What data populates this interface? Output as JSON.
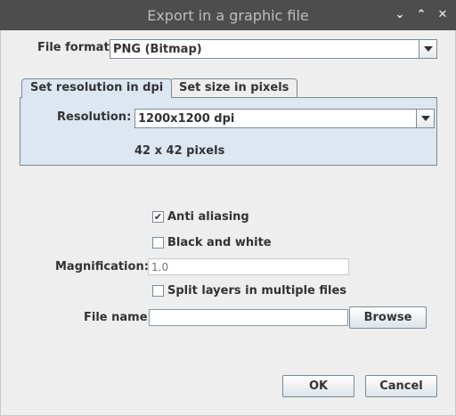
{
  "window": {
    "title": "Export in a graphic file",
    "controls": {
      "minimize_icon": "chevron-down-icon",
      "maximize_icon": "chevron-up-icon",
      "close_icon": "close-icon"
    }
  },
  "file_format": {
    "label": "File format:",
    "value": "PNG (Bitmap)"
  },
  "tabs": [
    {
      "label": "Set resolution in dpi",
      "active": true
    },
    {
      "label": "Set size in pixels",
      "active": false
    }
  ],
  "resolution": {
    "label": "Resolution:",
    "value": "1200x1200 dpi",
    "size_text": "42 x 42 pixels"
  },
  "options": {
    "anti_aliasing": {
      "label": "Anti aliasing",
      "checked": true
    },
    "black_and_white": {
      "label": "Black and white",
      "checked": false
    },
    "magnification": {
      "label": "Magnification:",
      "placeholder": "1.0"
    },
    "split_layers": {
      "label": "Split layers in multiple files",
      "checked": false
    },
    "file_name": {
      "label": "File name:",
      "value": ""
    },
    "browse_label": "Browse"
  },
  "actions": {
    "ok_label": "OK",
    "cancel_label": "Cancel"
  },
  "colors": {
    "titlebar": "#4d4d4d",
    "dialog_bg": "#eeeeee",
    "tab_active_bg": "#dce7f2",
    "border": "#7a8a99"
  }
}
